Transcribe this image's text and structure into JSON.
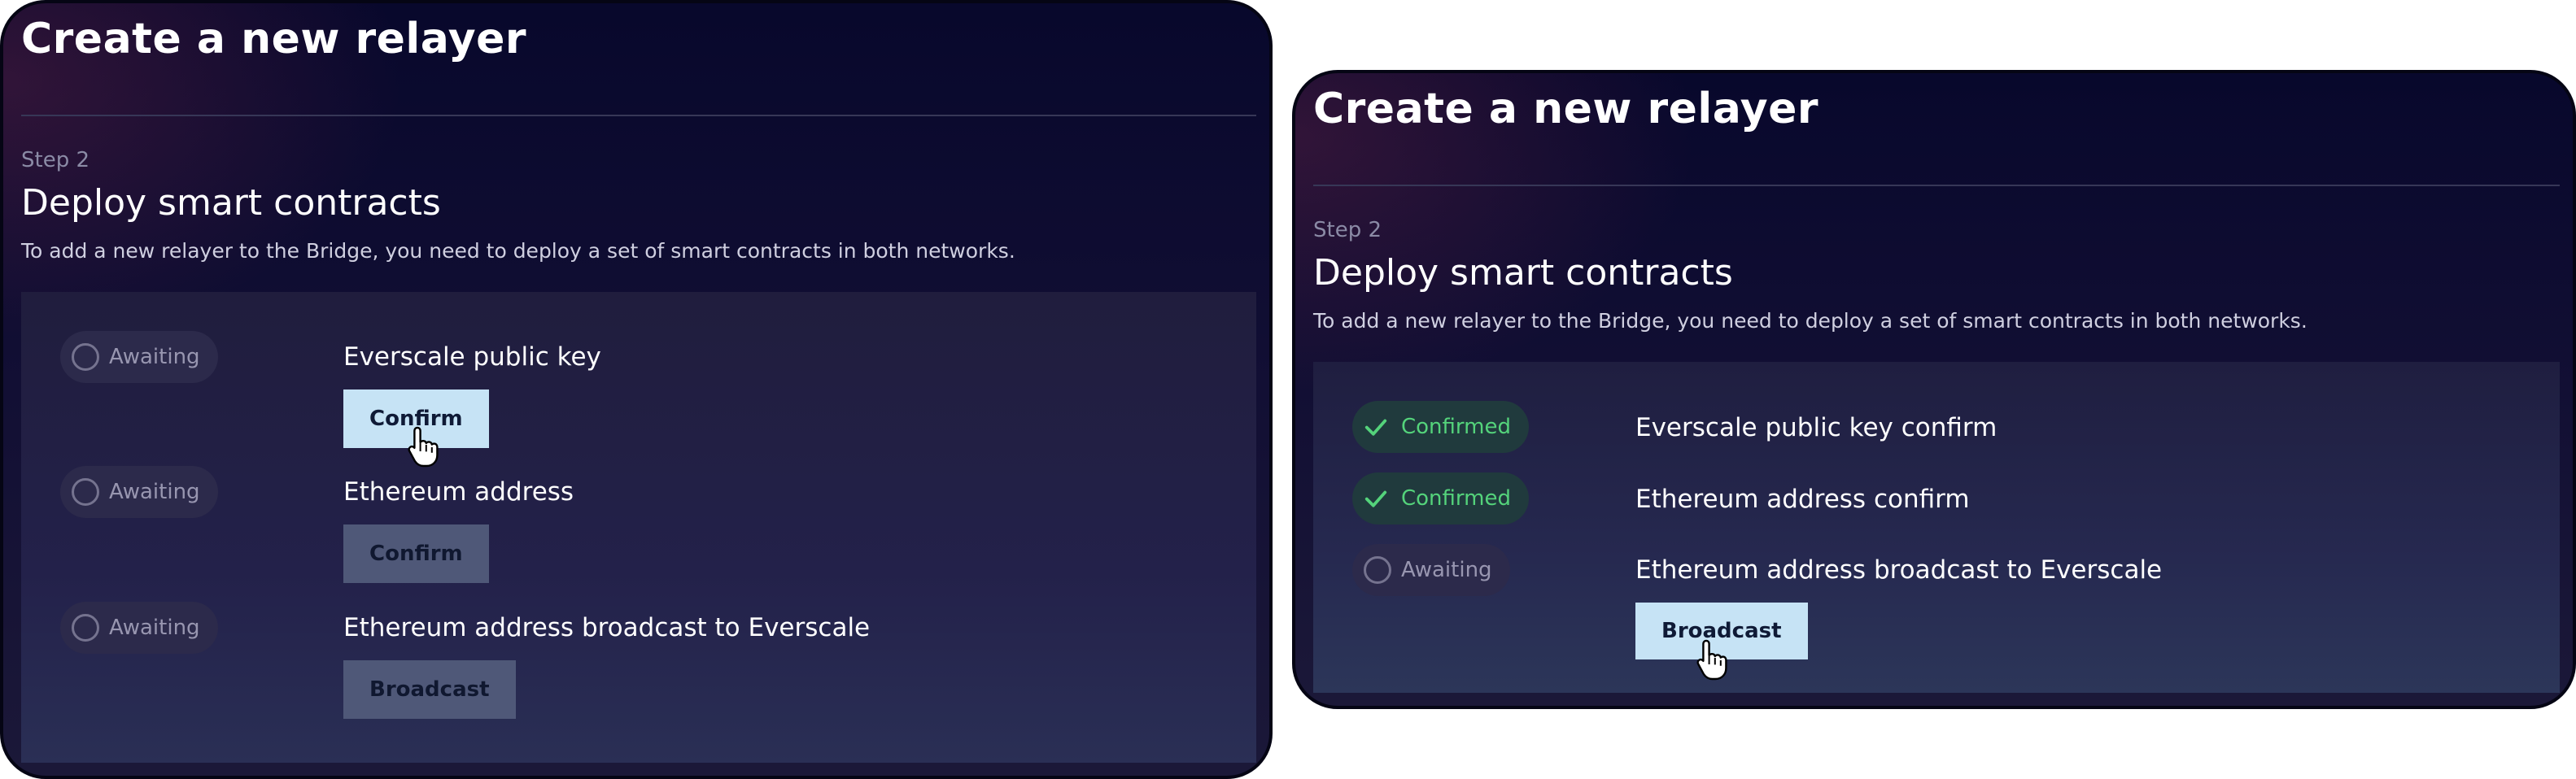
{
  "panels": [
    {
      "title": "Create a new relayer",
      "step": "Step 2",
      "heading": "Deploy smart contracts",
      "description": "To add a new relayer to the Bridge, you need to deploy a set of smart contracts in both networks.",
      "rows": [
        {
          "status": "Awaiting",
          "label": "Everscale public key",
          "button": "Confirm"
        },
        {
          "status": "Awaiting",
          "label": "Ethereum address",
          "button": "Confirm"
        },
        {
          "status": "Awaiting",
          "label": "Ethereum address broadcast to Everscale",
          "button": "Broadcast"
        }
      ]
    },
    {
      "title": "Create a new relayer",
      "step": "Step 2",
      "heading": "Deploy smart contracts",
      "description": "To add a new relayer to the Bridge, you need to deploy a set of smart contracts in both networks.",
      "rows": [
        {
          "status": "Confirmed",
          "label": "Everscale public key confirm"
        },
        {
          "status": "Confirmed",
          "label": "Ethereum address confirm"
        },
        {
          "status": "Awaiting",
          "label": "Ethereum address broadcast to Everscale",
          "button": "Broadcast"
        }
      ]
    }
  ],
  "colors": {
    "panel_bg": "#0d0b30",
    "card_bg": "#23214a",
    "confirmed": "#54d37b",
    "awaiting": "#9896b0",
    "button_active": "#c6e3f5",
    "button_inactive": "#4f5878"
  },
  "icons": {
    "pending": "circle-outline-icon",
    "confirmed": "checkmark-icon",
    "cursor": "hand-pointer-icon"
  }
}
